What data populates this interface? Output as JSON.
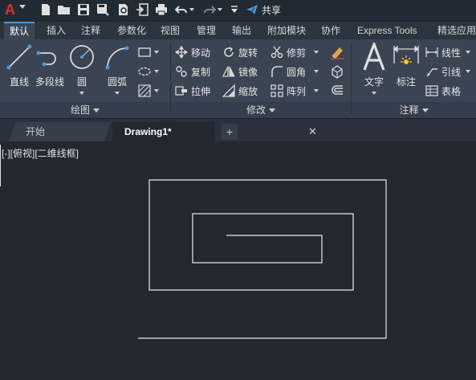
{
  "app": {
    "logo_letter": "A"
  },
  "quick_access": {
    "share_label": "共享",
    "icons": [
      "new-icon",
      "open-icon",
      "save-icon",
      "save-as-icon",
      "print-preview-icon",
      "export-icon",
      "import-icon",
      "print-icon",
      "undo-icon",
      "redo-icon",
      "dropdown-icon",
      "share-icon"
    ]
  },
  "ribbon_tabs": [
    "默认",
    "插入",
    "注释",
    "参数化",
    "视图",
    "管理",
    "输出",
    "附加模块",
    "协作",
    "Express Tools",
    "精选应用"
  ],
  "active_tab": "默认",
  "panels": {
    "draw": {
      "title": "绘图",
      "tools": [
        {
          "label": "直线",
          "icon": "line-icon"
        },
        {
          "label": "多段线",
          "icon": "polyline-icon"
        },
        {
          "label": "圆",
          "icon": "circle-icon"
        },
        {
          "label": "圆弧",
          "icon": "arc-icon"
        }
      ],
      "small_icons": [
        "rectangle-icon",
        "ellipse-icon",
        "hatch-icon"
      ]
    },
    "modify": {
      "title": "修改",
      "tools": [
        {
          "label": "移动",
          "icon": "move-icon"
        },
        {
          "label": "旋转",
          "icon": "rotate-icon"
        },
        {
          "label": "修剪",
          "icon": "trim-icon"
        },
        {
          "label": "复制",
          "icon": "copy-icon"
        },
        {
          "label": "镜像",
          "icon": "mirror-icon"
        },
        {
          "label": "圆角",
          "icon": "fillet-icon"
        },
        {
          "label": "拉伸",
          "icon": "stretch-icon"
        },
        {
          "label": "缩放",
          "icon": "scale-icon"
        },
        {
          "label": "阵列",
          "icon": "array-icon"
        }
      ]
    },
    "annotation": {
      "title": "注释",
      "text_label": "文字",
      "dim_label": "标注",
      "linear_label": "线性",
      "leader_label": "引线",
      "table_label": "表格"
    }
  },
  "file_tabs": {
    "start": "开始",
    "drawing": "Drawing1*",
    "close": "✕",
    "add": "+"
  },
  "viewport": {
    "label": "[-][俯视][二维线框]"
  },
  "colors": {
    "accent": "#4a9bd8",
    "logo": "#d9342b",
    "canvas_bg": "#212830",
    "line": "#e8e8e8"
  }
}
